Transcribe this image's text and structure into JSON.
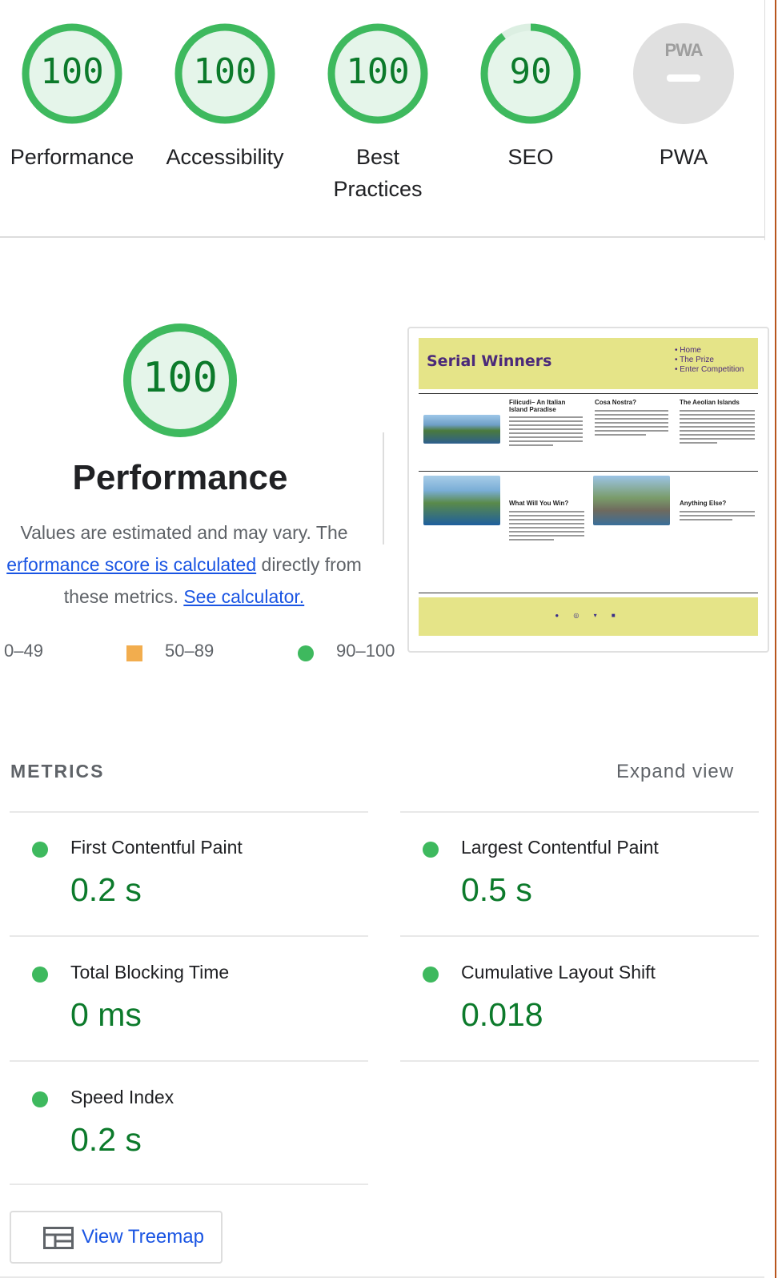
{
  "gauges": [
    {
      "score": "100",
      "label": "Performance",
      "fraction": 1.0
    },
    {
      "score": "100",
      "label": "Accessibility",
      "fraction": 1.0
    },
    {
      "score": "100",
      "label": "Best Practices",
      "fraction": 1.0
    },
    {
      "score": "90",
      "label": "SEO",
      "fraction": 0.9
    },
    {
      "score": "",
      "label": "PWA",
      "badge_text": "PWA"
    }
  ],
  "performance": {
    "score": "100",
    "title": "Performance",
    "desc_line1": "Values are estimated and may vary. The",
    "desc_link1": "erformance score is calculated",
    "desc_after_link1": " directly from",
    "desc_line3": "these metrics. ",
    "desc_link2": "See calculator."
  },
  "legend": {
    "fail": "0–49",
    "average": "50–89",
    "pass": "90–100"
  },
  "screenshot": {
    "site_title": "Serial Winners",
    "nav": [
      "• Home",
      "• The Prize",
      "• Enter Competition"
    ],
    "col1_title": "Filicudi– An Italian Island Paradise",
    "col2_title": "Cosa Nostra?",
    "col3_title": "The Aeolian Islands",
    "row2_col2_title": "What Will You Win?",
    "row2_col3_title": "Anything Else?",
    "footer_icons": "● ◎ ▾ ■"
  },
  "metrics": {
    "heading": "METRICS",
    "expand": "Expand view",
    "items": [
      {
        "name": "First Contentful Paint",
        "value": "0.2 s"
      },
      {
        "name": "Largest Contentful Paint",
        "value": "0.5 s"
      },
      {
        "name": "Total Blocking Time",
        "value": "0 ms"
      },
      {
        "name": "Cumulative Layout Shift",
        "value": "0.018"
      },
      {
        "name": "Speed Index",
        "value": "0.2 s"
      }
    ]
  },
  "treemap": {
    "label": "View Treemap"
  },
  "colors": {
    "pass": "#0c7a2b",
    "pass_ring": "#3eb95e",
    "pass_fill": "#e5f5ea",
    "average": "#f2ad4e",
    "link": "#1a55e3",
    "pwa_gray": "#e0e0e0"
  },
  "icons": [
    "pwa-badge-icon",
    "treemap-icon",
    "status-dot-icon",
    "average-square-icon"
  ]
}
